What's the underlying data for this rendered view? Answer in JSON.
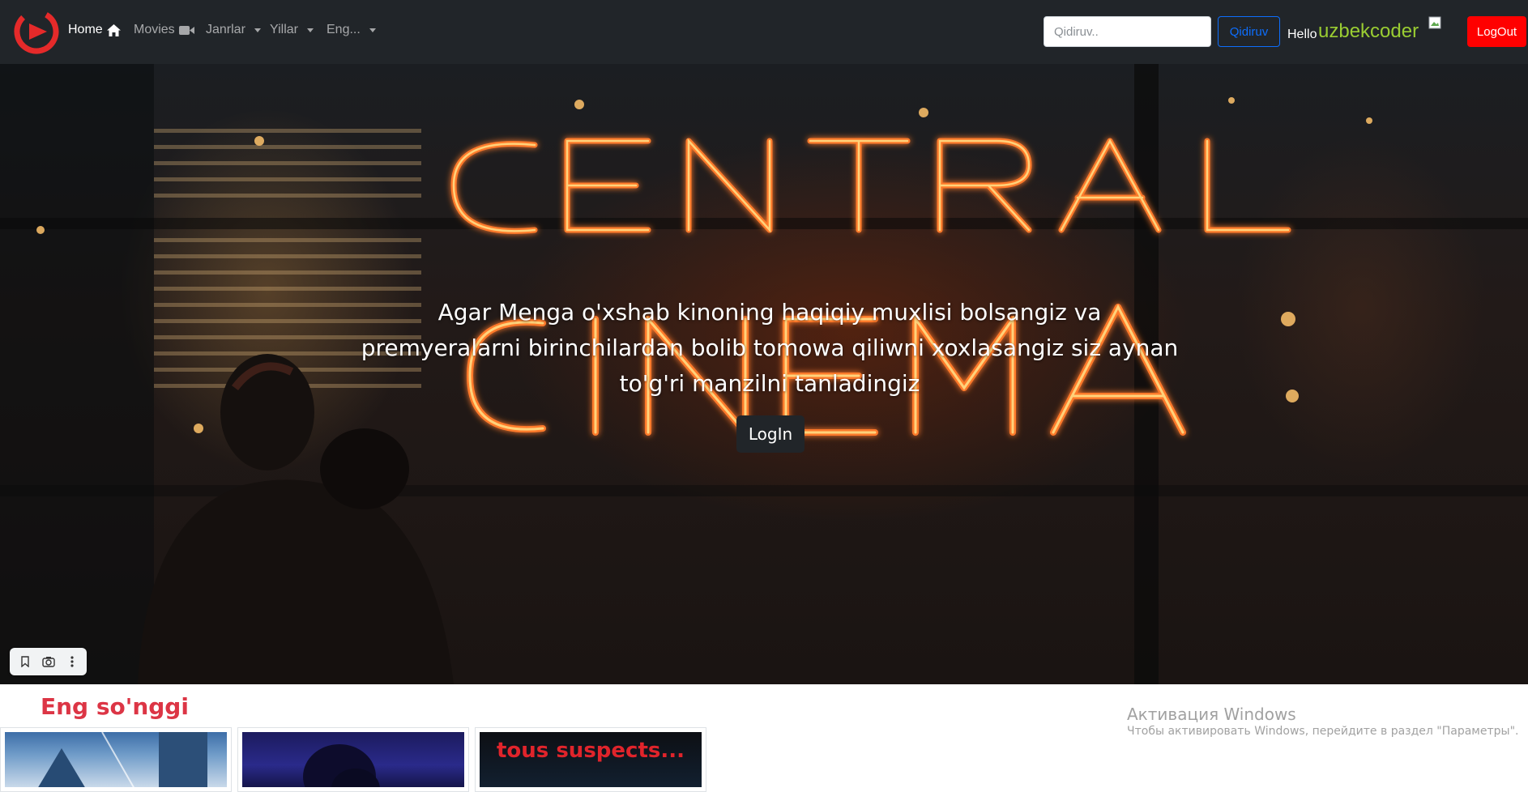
{
  "navbar": {
    "home_label": "Home",
    "movies_label": "Movies",
    "genres_label": "Janrlar",
    "years_label": "Yillar",
    "more_label": "Eng...",
    "search_placeholder": "Qidiruv..",
    "search_button": "Qidiruv",
    "hello": "Hello",
    "username": "uzbekcoder",
    "logout": "LogOut"
  },
  "hero": {
    "text": "Agar Menga o'xshab kinoning haqiqiy muxlisi bolsangiz va premyeralarni birinchilardan bolib tomowa qiliwni xoxlasangiz siz aynan to'g'ri manzilni tanladingiz",
    "login_button": "LogIn"
  },
  "latest": {
    "title": "Eng so'nggi",
    "cards": [
      {
        "poster_title": ""
      },
      {
        "poster_title": ""
      },
      {
        "poster_title": "tous suspects..."
      }
    ]
  },
  "watermark": {
    "title": "Активация Windows",
    "subtitle": "Чтобы активировать Windows, перейдите в раздел \"Параметры\"."
  },
  "colors": {
    "navbar_bg": "#212529",
    "logout_bg": "#ff0000",
    "username": "#9acd32",
    "section_title": "#dc3545",
    "search_button": "#0d6efd"
  }
}
